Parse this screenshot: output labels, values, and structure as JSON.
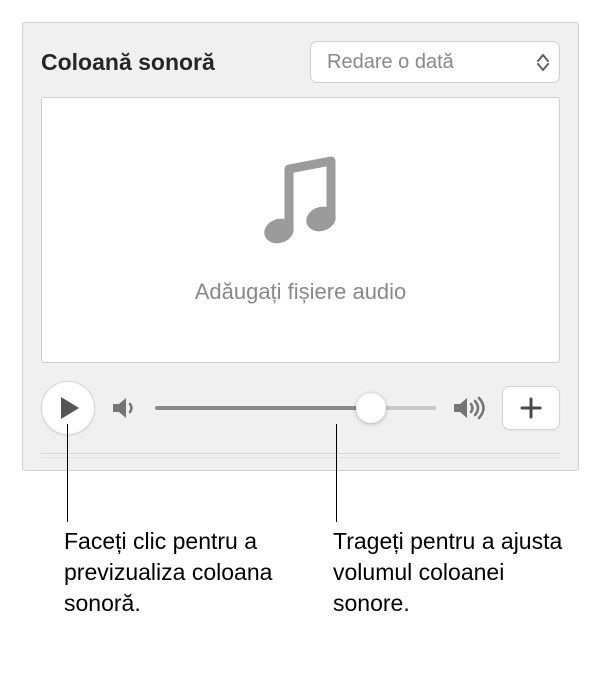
{
  "header": {
    "title": "Coloană sonoră",
    "dropdown_label": "Redare o dată"
  },
  "dropzone": {
    "text": "Adăugați fișiere audio"
  },
  "controls": {
    "volume_percent": 77
  },
  "callouts": {
    "play": "Faceți clic pentru a previzualiza coloana sonoră.",
    "volume": "Trageți pentru a ajusta volumul coloanei sonore."
  }
}
